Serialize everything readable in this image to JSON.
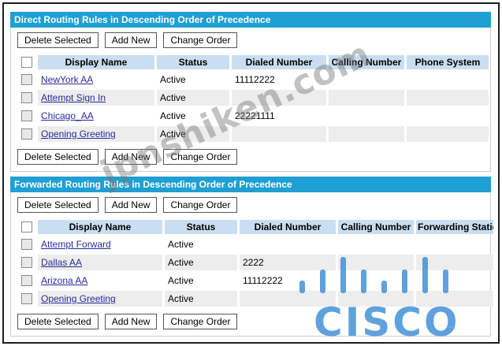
{
  "buttons": {
    "delete_selected": "Delete Selected",
    "add_new": "Add New",
    "change_order": "Change Order"
  },
  "direct": {
    "title": "Direct Routing Rules in Descending Order of Precedence",
    "columns": [
      "Display Name",
      "Status",
      "Dialed Number",
      "Calling Number",
      "Phone System"
    ],
    "rows": [
      {
        "name": "NewYork AA",
        "status": "Active",
        "dialed": "11112222",
        "calling": "",
        "system": ""
      },
      {
        "name": "Attempt Sign In",
        "status": "Active",
        "dialed": "",
        "calling": "",
        "system": ""
      },
      {
        "name": "Chicago_AA",
        "status": "Active",
        "dialed": "22221111",
        "calling": "",
        "system": ""
      },
      {
        "name": "Opening Greeting",
        "status": "Active",
        "dialed": "",
        "calling": "",
        "system": ""
      }
    ]
  },
  "forwarded": {
    "title": "Forwarded Routing Rules in Descending Order of Precedence",
    "columns": [
      "Display Name",
      "Status",
      "Dialed Number",
      "Calling Number",
      "Forwarding Station"
    ],
    "rows": [
      {
        "name": "Attempt Forward",
        "status": "Active",
        "dialed": "",
        "calling": "",
        "station": ""
      },
      {
        "name": "Dallas AA",
        "status": "Active",
        "dialed": "2222",
        "calling": "",
        "station": ""
      },
      {
        "name": "Arizona AA",
        "status": "Active",
        "dialed": "11112222",
        "calling": "",
        "station": ""
      },
      {
        "name": "Opening Greeting",
        "status": "Active",
        "dialed": "",
        "calling": "",
        "station": ""
      }
    ]
  },
  "watermark": "jpnshiken.com",
  "logo": {
    "text": "CISCO",
    "color": "#2882d2"
  }
}
